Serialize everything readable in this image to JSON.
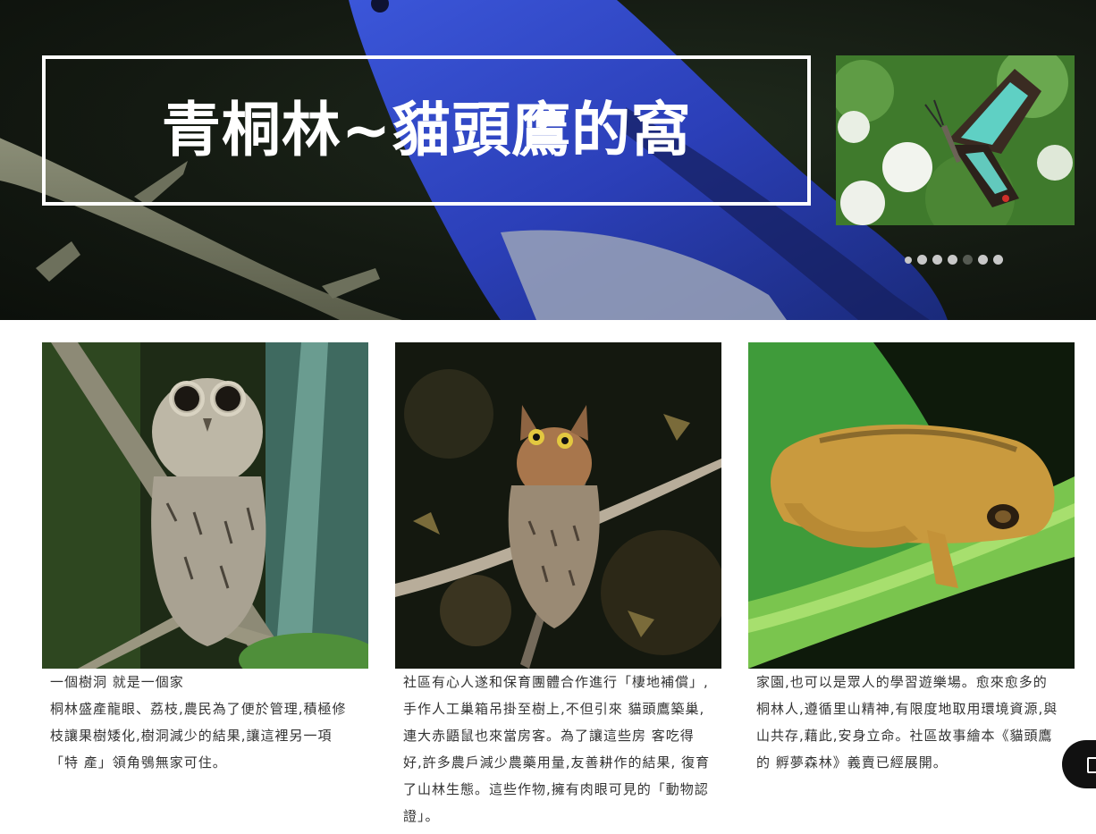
{
  "hero": {
    "title": "青桐林~貓頭鷹的窩",
    "thumbnail_subject": "butterfly-image",
    "slider_dots": [
      {
        "state": "normal"
      },
      {
        "state": "normal"
      },
      {
        "state": "normal"
      },
      {
        "state": "normal"
      },
      {
        "state": "active"
      },
      {
        "state": "normal"
      },
      {
        "state": "normal"
      }
    ]
  },
  "cards": [
    {
      "caption": "一個樹洞 就是一個家",
      "body": "桐林盛產龍眼、荔枝,農民為了便於管理,積極修枝讓果樹矮化,樹洞減少的結果,讓這裡另一項「特 產」領角鴞無家可住。"
    },
    {
      "caption": "",
      "body": "社區有心人遂和保育團體合作進行「棲地補償」,手作人工巢箱吊掛至樹上,不但引來 貓頭鷹築巢,連大赤鼯鼠也來當房客。為了讓這些房 客吃得好,許多農戶減少農藥用量,友善耕作的結果, 復育了山林生態。這些作物,擁有肉眼可見的「動物認 證」。"
    },
    {
      "caption": "",
      "body": "家園,也可以是眾人的學習遊樂場。愈來愈多的 桐林人,遵循里山精神,有限度地取用環境資源,與 山共存,藉此,安身立命。社區故事繪本《貓頭鷹的 孵夢森林》義賣已經展開。"
    }
  ],
  "colors": {
    "hero_bird": "#2f46c8",
    "text": "#333333",
    "border": "#ffffff"
  }
}
